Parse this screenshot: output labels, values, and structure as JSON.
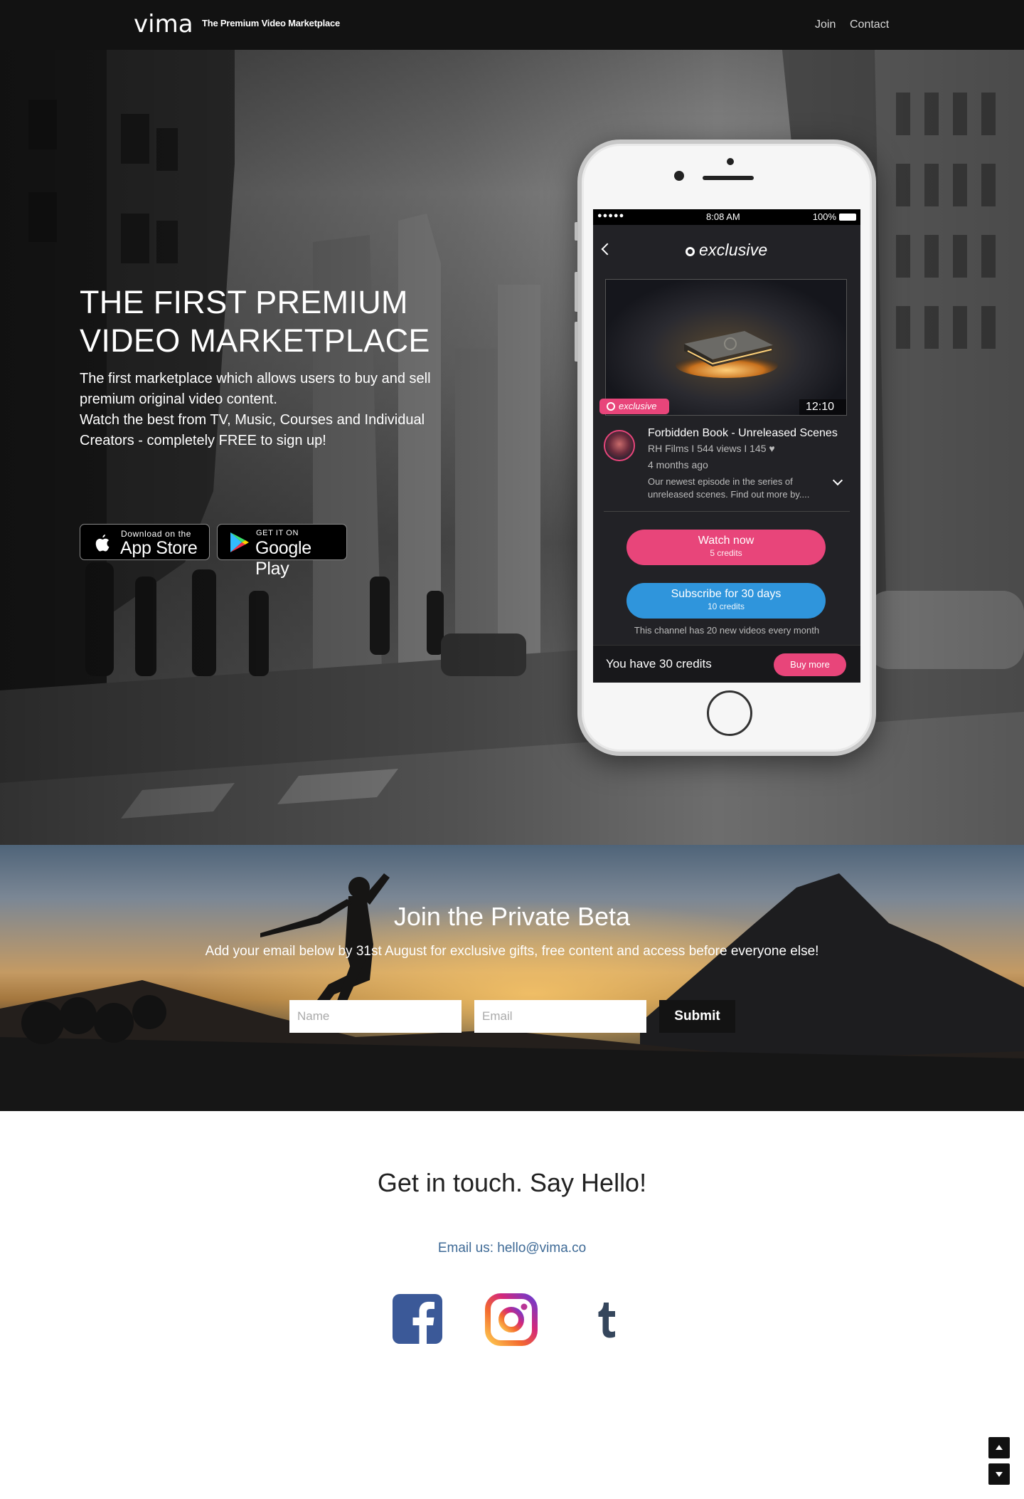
{
  "nav": {
    "logo": "vima",
    "tagline": "The Premium Video Marketplace",
    "links": [
      "Join",
      "Contact"
    ]
  },
  "hero": {
    "title_line1": "THE FIRST PREMIUM",
    "title_line2": "VIDEO MARKETPLACE",
    "text_line1": "The first marketplace which allows users to buy and sell",
    "text_line2": "premium original video content.",
    "text_line3": "Watch the best from TV, Music, Courses and Individual",
    "text_line4": "Creators - completely FREE to sign up!",
    "app_store": {
      "small": "Download on the",
      "big": "App Store"
    },
    "google_play": {
      "small": "GET IT ON",
      "big": "Google Play"
    }
  },
  "phone": {
    "status": {
      "signal": "●●●●●",
      "time": "8:08 AM",
      "battery": "100%"
    },
    "header_title": "exclusive",
    "badge": "exclusive",
    "duration": "12:10",
    "video_title": "Forbidden Book - Unreleased Scenes",
    "video_meta": "RH Films I  544 views  I  145 ♥",
    "video_age": "4 months ago",
    "video_desc": "Our newest episode in the series of unreleased scenes. Find out more by....",
    "watch_label": "Watch now",
    "watch_credits": "5 credits",
    "subscribe_label": "Subscribe for 30 days",
    "subscribe_credits": "10 credits",
    "channel_note": "This channel has 20 new videos every month",
    "credits_text": "You have 30 credits",
    "buy_more": "Buy more"
  },
  "beta": {
    "title": "Join the Private Beta",
    "subtitle": "Add your email below by 31st August for exclusive gifts, free content and access before everyone else!",
    "name_placeholder": "Name",
    "email_placeholder": "Email",
    "submit": "Submit"
  },
  "contact": {
    "title": "Get in touch. Say Hello!",
    "email": "Email us: hello@vima.co",
    "social": [
      "facebook-icon",
      "instagram-icon",
      "tumblr-icon"
    ]
  },
  "colors": {
    "accent_pink": "#e8457a",
    "accent_blue": "#2f95dc",
    "nav_bg": "#121212",
    "link_blue": "#3e6a96",
    "facebook": "#3b5998",
    "tumblr": "#35465c"
  }
}
